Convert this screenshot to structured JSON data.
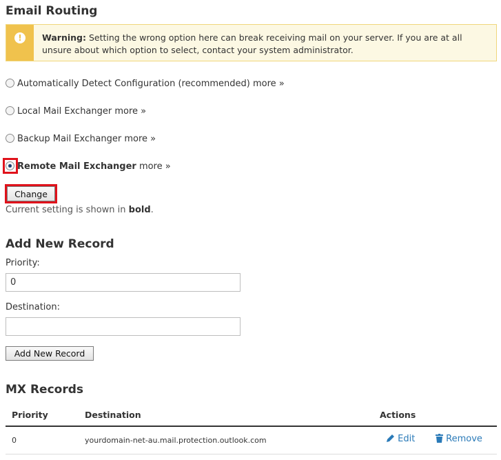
{
  "email_routing": {
    "title": "Email Routing",
    "warning": {
      "bold": "Warning:",
      "text": " Setting the wrong option here can break receiving mail on your server. If you are at all unsure about which option to select, contact your system administrator."
    },
    "options": [
      {
        "label": "Automatically Detect Configuration (recommended)",
        "more": "more »",
        "checked": false
      },
      {
        "label": "Local Mail Exchanger",
        "more": "more »",
        "checked": false
      },
      {
        "label": "Backup Mail Exchanger",
        "more": "more »",
        "checked": false
      },
      {
        "label": "Remote Mail Exchanger",
        "more": "more »",
        "checked": true
      }
    ],
    "change_button": "Change",
    "note_prefix": "Current setting is shown in ",
    "note_bold": "bold",
    "note_suffix": "."
  },
  "add_record": {
    "title": "Add New Record",
    "priority_label": "Priority:",
    "priority_value": "0",
    "destination_label": "Destination:",
    "destination_value": "",
    "submit_button": "Add New Record"
  },
  "mx_records": {
    "title": "MX Records",
    "columns": [
      "Priority",
      "Destination",
      "Actions"
    ],
    "rows": [
      {
        "priority": "0",
        "destination": "yourdomain-net-au.mail.protection.outlook.com",
        "edit": "Edit",
        "remove": "Remove"
      }
    ]
  },
  "colors": {
    "highlight": "#e0121b",
    "link": "#2a7ab8",
    "warning_bg": "#fcf8e3",
    "warning_accent": "#f0c24d"
  }
}
